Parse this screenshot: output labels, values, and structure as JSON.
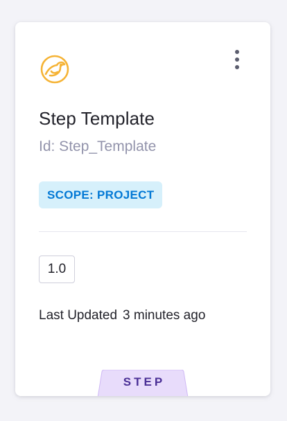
{
  "card": {
    "icon": "template-bird-icon",
    "menu_icon": "more-vertical-icon",
    "title": "Step Template",
    "id_text": "Id: Step_Template",
    "scope_badge": "SCOPE: PROJECT",
    "version": "1.0",
    "last_updated_label": "Last Updated",
    "last_updated_value": "3 minutes ago",
    "type_label": "STEP"
  },
  "colors": {
    "icon_accent": "#f5b335",
    "scope_badge_bg": "#d6f0fb",
    "scope_badge_text": "#0278d5",
    "type_tab_bg": "#e8dcfb",
    "type_tab_border": "#cfb8f5",
    "type_tab_text": "#4a2f96"
  }
}
